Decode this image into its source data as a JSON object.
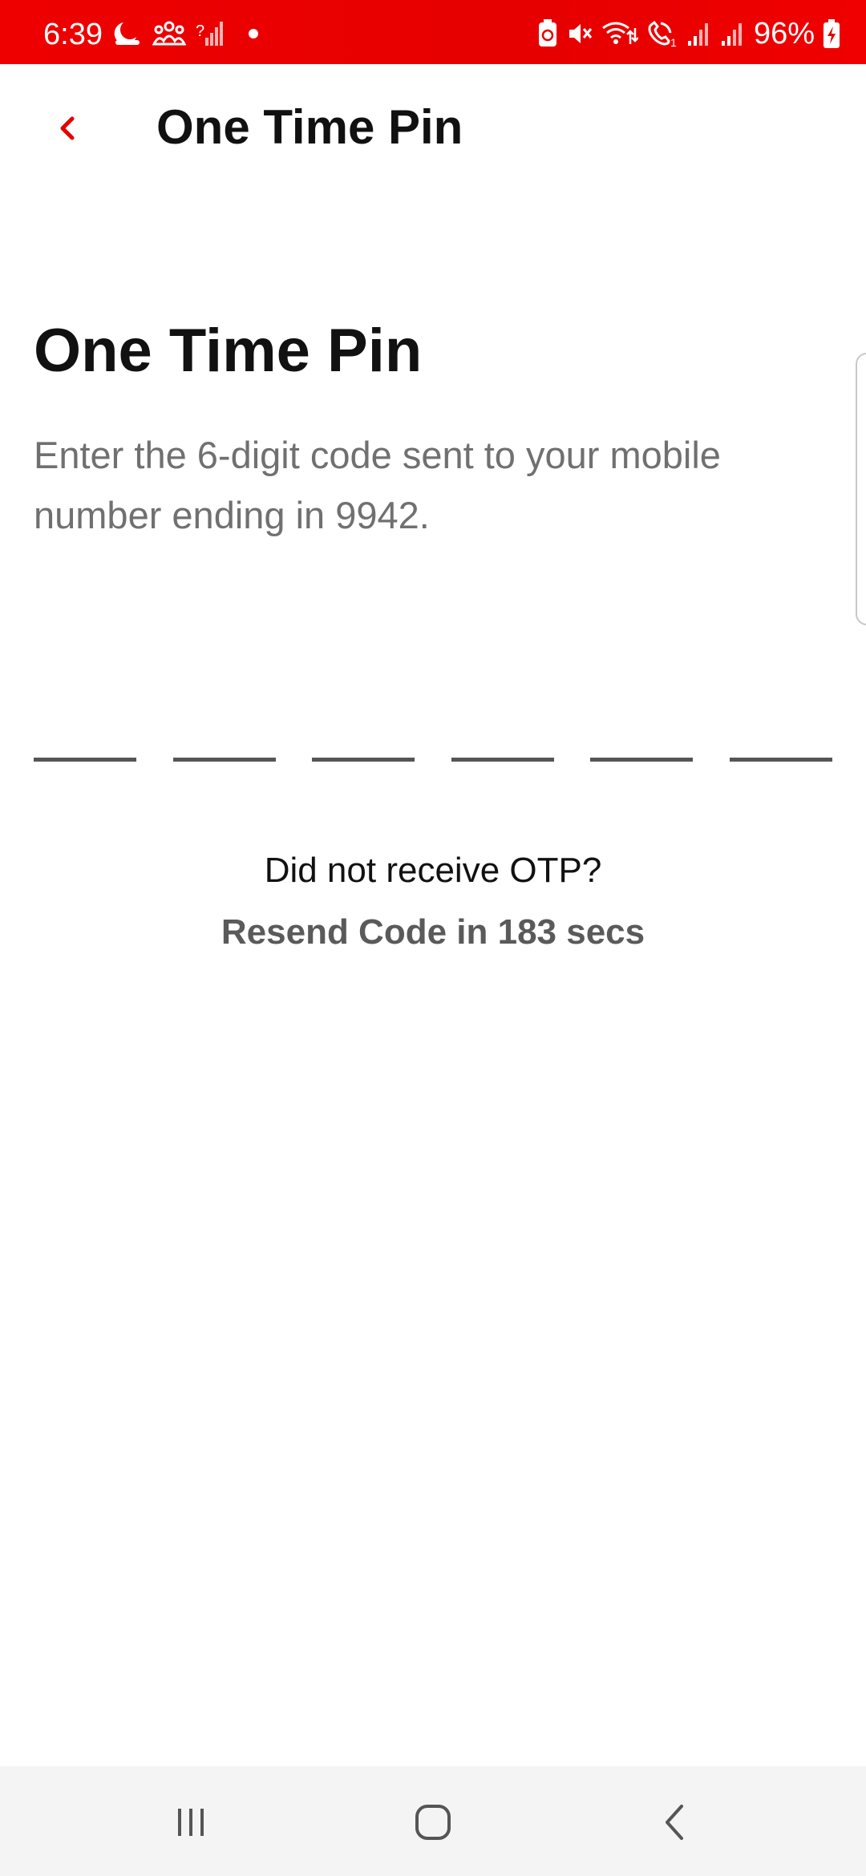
{
  "status_bar": {
    "time": "6:39",
    "battery_percent": "96%",
    "background_color": "#e60000",
    "left_icons": [
      "moon-icon",
      "people-icon",
      "signal-question-icon",
      "notification-dot-icon"
    ],
    "right_icons": [
      "battery-saver-icon",
      "mute-icon",
      "wifi-calling-icon",
      "volte-call-icon",
      "signal-sim1-icon",
      "signal-sim2-icon",
      "battery-charging-icon"
    ]
  },
  "app_bar": {
    "title": "One Time Pin",
    "back_icon": "chevron-left-icon",
    "accent_color": "#e60000"
  },
  "main": {
    "heading": "One Time Pin",
    "description": "Enter the 6-digit code sent to your mobile number ending in 9942.",
    "otp_digits": [
      "",
      "",
      "",
      "",
      "",
      ""
    ],
    "not_received_text": "Did not receive OTP?",
    "resend_text": "Resend Code in 183 secs"
  },
  "nav_bar": {
    "icons": [
      "recent-apps-icon",
      "home-icon",
      "back-icon"
    ]
  }
}
